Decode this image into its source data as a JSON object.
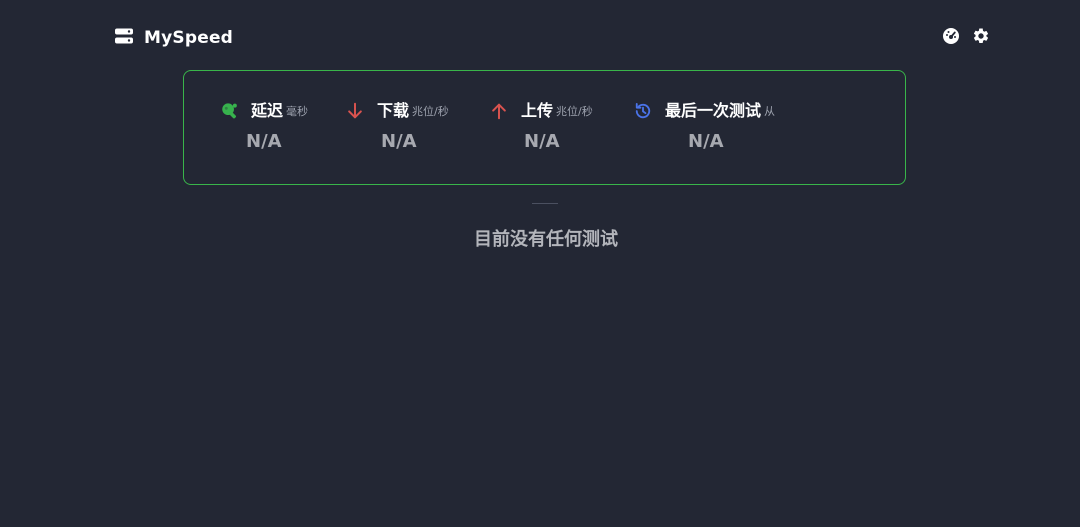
{
  "app": {
    "title": "MySpeed"
  },
  "stats": [
    {
      "label": "延迟",
      "unit": "毫秒",
      "value": "N/A",
      "icon": "ping-pong-icon"
    },
    {
      "label": "下载",
      "unit": "兆位/秒",
      "value": "N/A",
      "icon": "arrow-down-icon"
    },
    {
      "label": "上传",
      "unit": "兆位/秒",
      "value": "N/A",
      "icon": "arrow-up-icon"
    },
    {
      "label": "最后一次测试",
      "unit": "从",
      "value": "N/A",
      "icon": "history-icon"
    }
  ],
  "empty_state": {
    "message": "目前没有任何测试"
  },
  "colors": {
    "background": "#232734",
    "card_border": "#39b54a",
    "ping": "#37b24d",
    "download": "#d9534f",
    "upload": "#d9534f",
    "history": "#4a73e8",
    "text": "#ffffff",
    "muted": "#9da2ae"
  }
}
